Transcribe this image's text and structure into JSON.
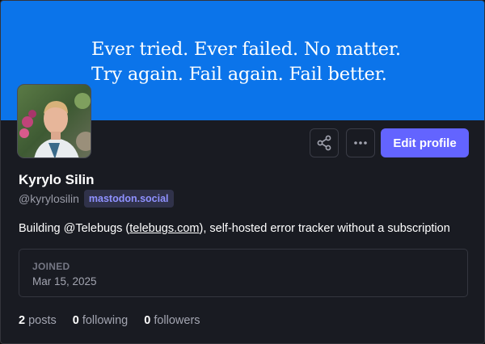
{
  "banner": {
    "quote_line1": "Ever tried. Ever failed. No matter.",
    "quote_line2": "Try again. Fail again. Fail better.",
    "color": "#0b74ea"
  },
  "profile": {
    "display_name": "Kyrylo Silin",
    "handle": "@kyrylosilin",
    "server": "mastodon.social",
    "bio_before": "Building @Telebugs (",
    "bio_link": "telebugs.com",
    "bio_after": "), self-hosted error tracker without a subscription"
  },
  "actions": {
    "share_icon": "share-icon",
    "more_icon": "more-options-icon",
    "edit_label": "Edit profile",
    "accent_color": "#6364ff"
  },
  "joined": {
    "label": "JOINED",
    "date": "Mar 15, 2025"
  },
  "stats": [
    {
      "count": "2",
      "label": "posts"
    },
    {
      "count": "0",
      "label": "following"
    },
    {
      "count": "0",
      "label": "followers"
    }
  ]
}
